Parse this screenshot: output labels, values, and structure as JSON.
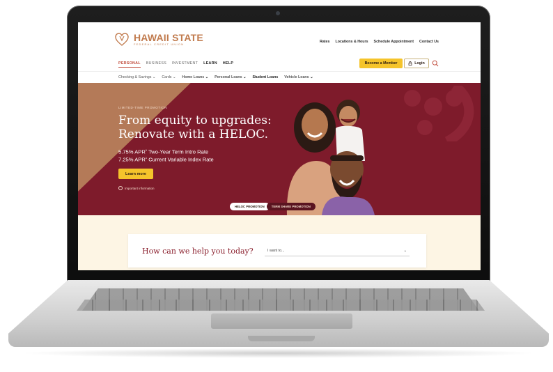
{
  "brand": {
    "name": "HAWAII STATE",
    "sub": "FEDERAL CREDIT UNION",
    "color": "#c17b4e"
  },
  "utility_nav": [
    "Rates",
    "Locations & Hours",
    "Schedule Appointment",
    "Contact Us"
  ],
  "main_nav": [
    {
      "label": "PERSONAL",
      "active": true
    },
    {
      "label": "BUSINESS",
      "active": false
    },
    {
      "label": "INVESTMENT",
      "active": false
    },
    {
      "label": "LEARN",
      "active": false
    },
    {
      "label": "HELP",
      "active": false
    }
  ],
  "actions": {
    "member_label": "Become a Member",
    "login_label": "Login"
  },
  "sub_nav": [
    "Checking & Savings",
    "Cards",
    "Home Loans",
    "Personal Loans",
    "Student Loans",
    "Vehicle Loans"
  ],
  "hero": {
    "eyebrow": "LIMITED-TIME PROMOTION",
    "title_line1": "From equity to upgrades:",
    "title_line2": "Renovate with a HELOC.",
    "rate1_value": "5.75% APR",
    "rate1_sup": "1",
    "rate1_text": "Two-Year Term Intro Rate",
    "rate2_value": "7.25% APR",
    "rate2_sup": "1",
    "rate2_text": "Current Variable Index Rate",
    "cta_label": "Learn more",
    "info_label": "Important information",
    "bg_color": "#7e1b2b",
    "accent_color": "#f5c42b"
  },
  "promo_tabs": [
    {
      "label": "HELOC PROMOTION",
      "active": true
    },
    {
      "label": "TERM SHARE PROMOTION",
      "active": false
    }
  ],
  "help": {
    "title": "How can we help you today?",
    "select_value": "I want to..."
  }
}
